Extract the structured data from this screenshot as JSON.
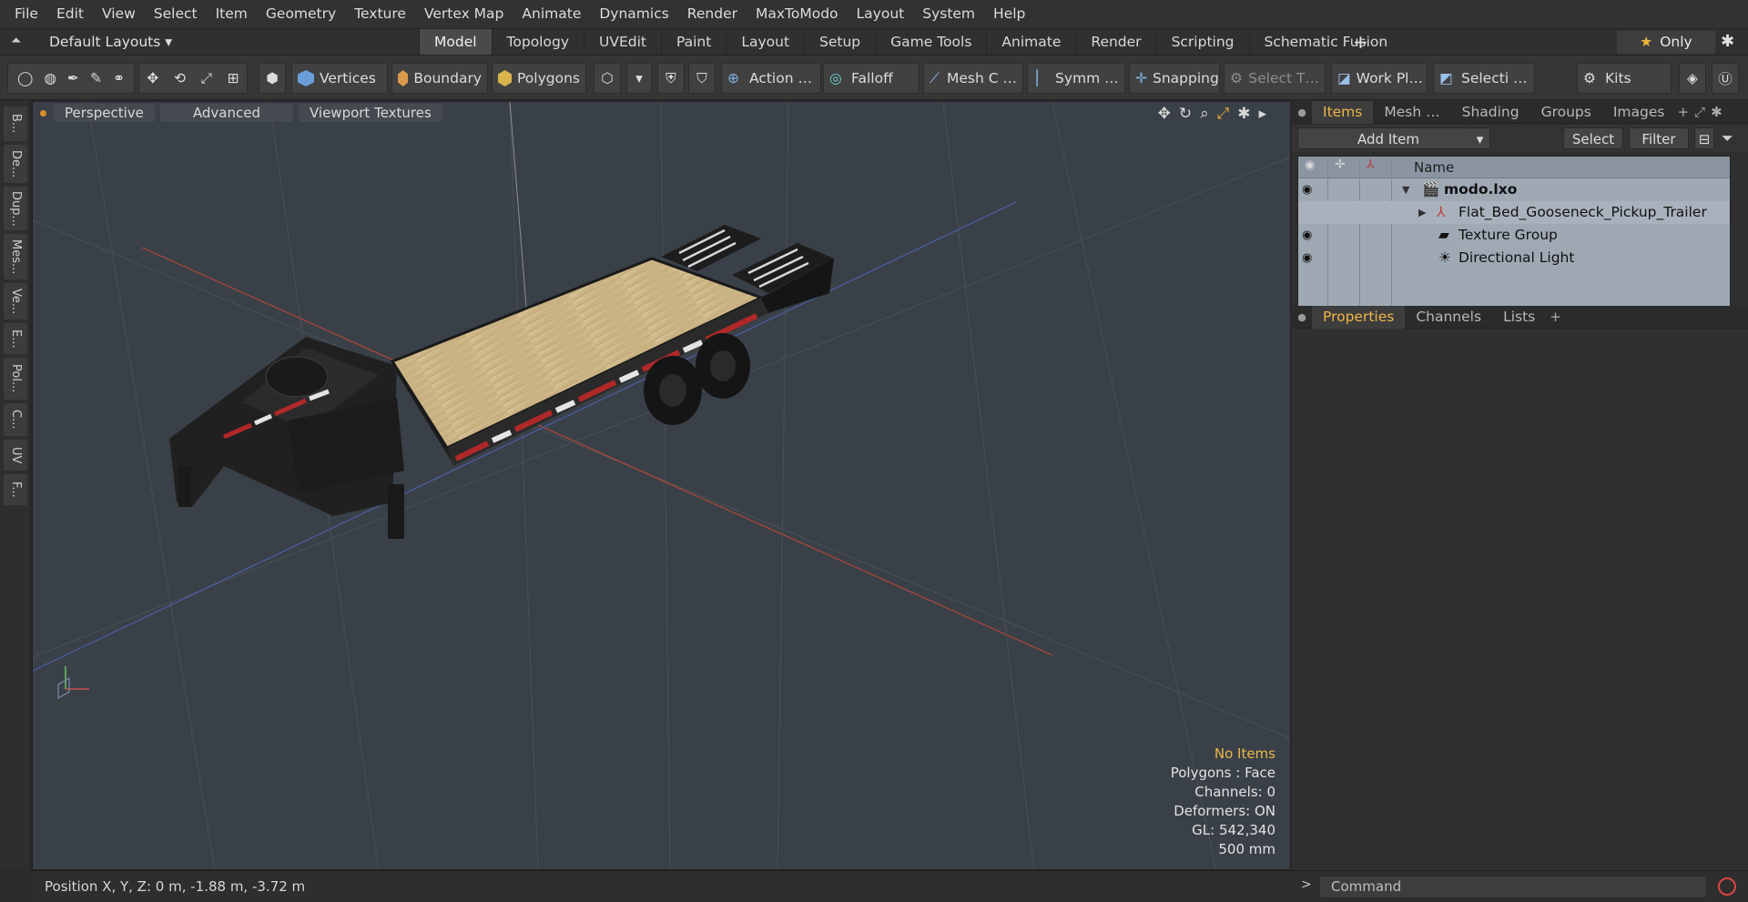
{
  "menu": [
    "File",
    "Edit",
    "View",
    "Select",
    "Item",
    "Geometry",
    "Texture",
    "Vertex Map",
    "Animate",
    "Dynamics",
    "Render",
    "MaxToModo",
    "Layout",
    "System",
    "Help"
  ],
  "layouts_label": "Default Layouts ▾",
  "layout_tabs": [
    {
      "label": "Model",
      "active": true
    },
    {
      "label": "Topology"
    },
    {
      "label": "UVEdit"
    },
    {
      "label": "Paint"
    },
    {
      "label": "Layout"
    },
    {
      "label": "Setup"
    },
    {
      "label": "Game Tools"
    },
    {
      "label": "Animate"
    },
    {
      "label": "Render"
    },
    {
      "label": "Scripting"
    },
    {
      "label": "Schematic Fusion"
    }
  ],
  "only_label": "Only",
  "toolbar": {
    "vertices": "Vertices",
    "boundary": "Boundary",
    "polygons": "Polygons",
    "action": "Action …",
    "falloff": "Falloff",
    "mesh": "Mesh C …",
    "symm": "Symm …",
    "snapping": "Snapping",
    "select_t": "Select T…",
    "work_pl": "Work Pl…",
    "selecti": "Selecti …",
    "kits": "Kits"
  },
  "left_tabs": [
    "B...",
    "De...",
    "Dup...",
    "Mes...",
    "Ve...",
    "E...",
    "Pol...",
    "C...",
    "UV",
    "F..."
  ],
  "viewport": {
    "perspective": "Perspective",
    "advanced": "Advanced",
    "viewport_textures": "Viewport Textures",
    "stats": {
      "no_items": "No Items",
      "polygons": "Polygons : Face",
      "channels": "Channels: 0",
      "deformers": "Deformers: ON",
      "gl": "GL: 542,340",
      "scale": "500 mm"
    }
  },
  "status_position": "Position X, Y, Z:   0 m, -1.88 m, -3.72 m",
  "items_panel": {
    "tabs": [
      {
        "label": "Items",
        "active": true
      },
      {
        "label": "Mesh …"
      },
      {
        "label": "Shading"
      },
      {
        "label": "Groups"
      },
      {
        "label": "Images"
      }
    ],
    "add_item": "Add Item",
    "select": "Select",
    "filter": "Filter",
    "name_header": "Name",
    "rows": [
      {
        "label": "modo.lxo",
        "bold": true
      },
      {
        "label": "Flat_Bed_Gooseneck_Pickup_Trailer"
      },
      {
        "label": "Texture Group"
      },
      {
        "label": "Directional Light"
      }
    ]
  },
  "props_panel": {
    "tabs": [
      {
        "label": "Properties",
        "active": true
      },
      {
        "label": "Channels"
      },
      {
        "label": "Lists"
      }
    ]
  },
  "command_placeholder": "Command"
}
